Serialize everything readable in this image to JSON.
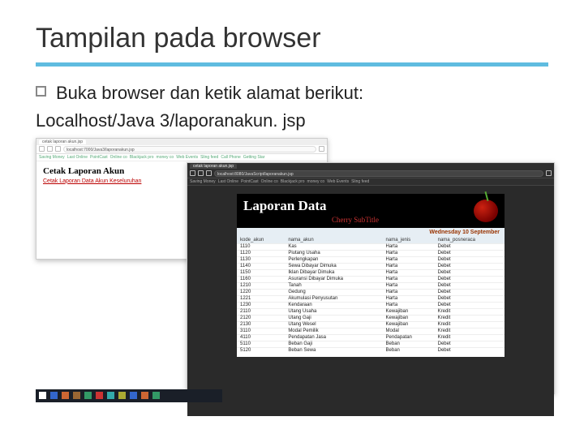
{
  "slide": {
    "title": "Tampilan pada browser",
    "bullet": "Buka browser dan ketik alamat berikut:",
    "url": "Localhost/Java 3/laporanakun. jsp"
  },
  "browser1": {
    "tab": "cetak laporan akun.jsp",
    "address": "localhost:7000/Java3/laporanakun.jsp",
    "bookmarks": [
      "Saving Money",
      "Last Online",
      "PointCast",
      "Online co",
      "Blackjack pro",
      "money co",
      "Web Events",
      "Sling feed",
      "Call Phone",
      "Getting Star"
    ],
    "pageHeading": "Cetak Laporan Akun",
    "pageLink": "Cetak Laporan Data Akun Keseluruhan"
  },
  "browser2": {
    "tab": "cetak laporan akun.jsp",
    "address": "localhost:8080/JavaScript/laporanakun.jsp",
    "bookmarks": [
      "Saving Money",
      "Last Online",
      "PointCast",
      "Online co",
      "Blackjack pro",
      "money co",
      "Web Events",
      "Sling feed"
    ],
    "report": {
      "title": "Laporan Data",
      "subtitle": "Cherry SubTitle",
      "dateline": "Wednesday 10 September",
      "headers": [
        "kode_akun",
        "nama_akun",
        "nama_jenis",
        "nama_posneraca"
      ],
      "rows": [
        [
          "1110",
          "Kas",
          "Harta",
          "Debet"
        ],
        [
          "1120",
          "Piutang Usaha",
          "Harta",
          "Debet"
        ],
        [
          "1130",
          "Perlengkapan",
          "Harta",
          "Debet"
        ],
        [
          "1140",
          "Sewa Dibayar Dimuka",
          "Harta",
          "Debet"
        ],
        [
          "1150",
          "Iklan Dibayar Dimuka",
          "Harta",
          "Debet"
        ],
        [
          "1160",
          "Asuransi Dibayar Dimuka",
          "Harta",
          "Debet"
        ],
        [
          "1210",
          "Tanah",
          "Harta",
          "Debet"
        ],
        [
          "1220",
          "Gedung",
          "Harta",
          "Debet"
        ],
        [
          "1221",
          "Akumulasi Penyusutan",
          "Harta",
          "Debet"
        ],
        [
          "1230",
          "Kendaraan",
          "Harta",
          "Debet"
        ],
        [
          "2110",
          "Utang Usaha",
          "Kewajiban",
          "Kredit"
        ],
        [
          "2120",
          "Utang Gaji",
          "Kewajiban",
          "Kredit"
        ],
        [
          "2130",
          "Utang Wesel",
          "Kewajiban",
          "Kredit"
        ],
        [
          "3110",
          "Modal Pemilik",
          "Modal",
          "Kredit"
        ],
        [
          "4110",
          "Pendapatan Jasa",
          "Pendapatan",
          "Kredit"
        ],
        [
          "5110",
          "Beban Gaji",
          "Beban",
          "Debet"
        ],
        [
          "5120",
          "Beban Sewa",
          "Beban",
          "Debet"
        ]
      ]
    }
  }
}
